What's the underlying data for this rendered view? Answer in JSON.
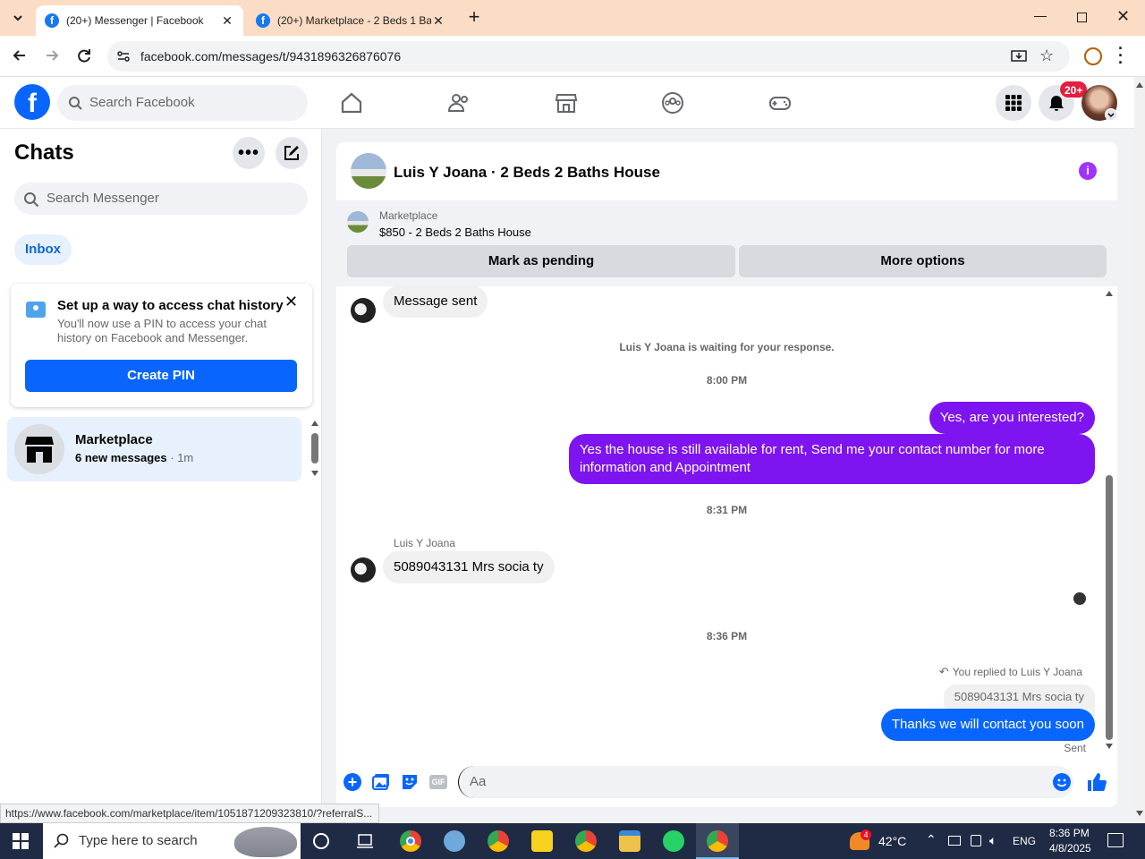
{
  "browser": {
    "tabs": [
      {
        "title": "(20+) Messenger | Facebook",
        "active": true
      },
      {
        "title": "(20+) Marketplace - 2 Beds 1 Ba",
        "active": false
      }
    ],
    "url": "facebook.com/messages/t/9431896326876076"
  },
  "fb": {
    "logo": "f",
    "search_placeholder": "Search Facebook",
    "notification_badge": "20+"
  },
  "sidebar": {
    "title": "Chats",
    "search_placeholder": "Search Messenger",
    "inbox_label": "Inbox",
    "pin_card": {
      "title": "Set up a way to access chat history",
      "body": "You'll now use a PIN to access your chat history on Facebook and Messenger.",
      "button": "Create PIN"
    },
    "conversations": [
      {
        "name": "Marketplace",
        "preview": "6 new messages",
        "time": "· 1m"
      }
    ]
  },
  "chat": {
    "title": "Luis Y Joana · 2 Beds 2 Baths House",
    "marketplace": {
      "label": "Marketplace",
      "listing": "$850 - 2 Beds 2 Baths House",
      "pending_button": "Mark as pending",
      "options_button": "More options"
    },
    "messages": {
      "m1": "Message sent",
      "waiting": "Luis Y Joana is waiting for your response.",
      "t1": "8:00 PM",
      "m2": "Yes, are you interested?",
      "m3": "Yes the house is still available for rent, Send me your contact number for more information and Appointment",
      "t2": "8:31 PM",
      "sender": "Luis Y Joana",
      "m4": "5089043131 Mrs socia ty",
      "t3": "8:36 PM",
      "reply_label": "You replied to Luis Y Joana",
      "reply_quote": "5089043131 Mrs socia ty",
      "m5": "Thanks we will contact you soon",
      "sent": "Sent"
    },
    "composer_placeholder": "Aa",
    "gif_label": "GIF"
  },
  "status_url": "https://www.facebook.com/marketplace/item/1051871209323810/?referralS...",
  "taskbar": {
    "search_placeholder": "Type here to search",
    "weather_badge": "4",
    "temperature": "42°C",
    "language": "ENG",
    "time": "8:36 PM",
    "date": "4/8/2025"
  },
  "colors": {
    "fb_blue": "#0866ff",
    "messenger_purple": "#7e14f0",
    "tab_strip": "#fbdcc5"
  }
}
